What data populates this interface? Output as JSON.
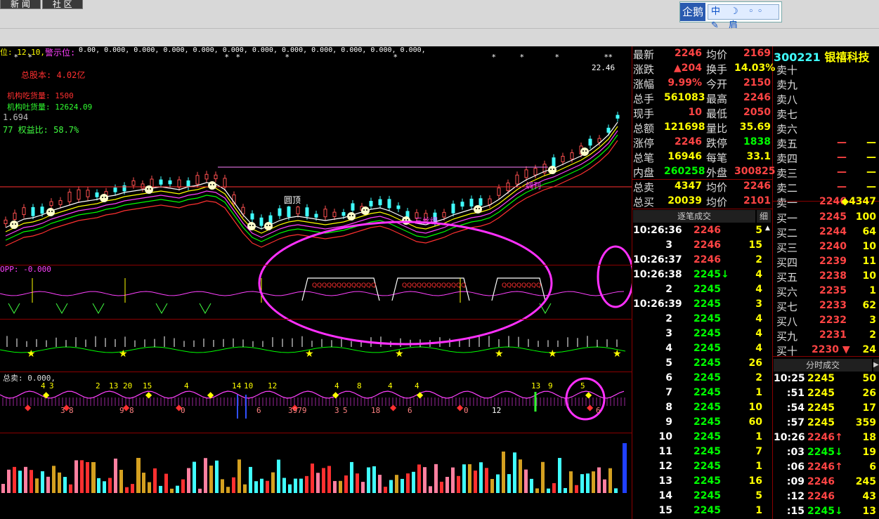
{
  "tabs": [
    "新 闻",
    "社 区"
  ],
  "qq": {
    "avatar": "企鹅",
    "tools": "中 ☽ ◦◦ ✎ 肩"
  },
  "indicators": {
    "warn": "位: 12.10,",
    "alarm_label": "警示位:",
    "alarm_values": "0.00, 0.000, 0.000, 0.000, 0.000, 0.000, 0.000, 0.000, 0.000, 0.000, 0.000, 0.000,",
    "equity": "总股本: 4.02亿",
    "inst_buy": "机构吃货量: 1500",
    "inst_sell": "机构吐货量: 12624.09",
    "v1": "1.694",
    "ratio": "77    权益比: 58.7%",
    "price_top": "22.46",
    "opp": "OPP: -0.000",
    "total_sell": "总卖: 0.000,"
  },
  "annotations": {
    "round_top": "圆顶",
    "shaokai": "绸刊",
    "sanqing": "三丝绸"
  },
  "subchart_numbers": {
    "top": [
      "4",
      "3",
      "2",
      "13",
      "20",
      "15",
      "4",
      "14",
      "10",
      "12",
      "4",
      "8",
      "4",
      "4",
      "13",
      "9",
      "5"
    ],
    "bottom": [
      "3",
      "8",
      "9",
      "8",
      "0",
      "6",
      "3979",
      "3",
      "5",
      "18",
      "6",
      "12",
      "0",
      "6"
    ]
  },
  "stock": {
    "code": "300221",
    "name": "银禧科技"
  },
  "quote": [
    {
      "l1": "最新",
      "v1": "2246",
      "c1": "#f44",
      "l2": "均价",
      "v2": "2169",
      "c2": "#f44"
    },
    {
      "l1": "涨跌",
      "v1": "▲204",
      "c1": "#f44",
      "l2": "换手",
      "v2": "14.03%",
      "c2": "#ffff00"
    },
    {
      "l1": "涨幅",
      "v1": "9.99%",
      "c1": "#f44",
      "l2": "今开",
      "v2": "2150",
      "c2": "#f44"
    },
    {
      "l1": "总手",
      "v1": "561083",
      "c1": "#ffff00",
      "l2": "最高",
      "v2": "2246",
      "c2": "#f44"
    },
    {
      "l1": "现手",
      "v1": "10",
      "c1": "#f44",
      "l2": "最低",
      "v2": "2050",
      "c2": "#f44"
    },
    {
      "l1": "总额",
      "v1": "121698",
      "c1": "#ffff00",
      "l2": "量比",
      "v2": "35.69",
      "c2": "#ffff00"
    },
    {
      "l1": "涨停",
      "v1": "2246",
      "c1": "#f44",
      "l2": "跌停",
      "v2": "1838",
      "c2": "#0f0"
    },
    {
      "l1": "总笔",
      "v1": "16946",
      "c1": "#ffff00",
      "l2": "每笔",
      "v2": "33.1",
      "c2": "#ffff00"
    },
    {
      "l1": "内盘",
      "v1": "260258",
      "c1": "#0f0",
      "l2": "外盘",
      "v2": "300825",
      "c2": "#f44"
    },
    {
      "l1": "总卖",
      "v1": "4347",
      "c1": "#ffff00",
      "l2": "均价",
      "v2": "2246",
      "c2": "#f44"
    },
    {
      "l1": "总买",
      "v1": "20039",
      "c1": "#ffff00",
      "l2": "均价",
      "v2": "2101",
      "c2": "#f44"
    }
  ],
  "sells": [
    {
      "l": "卖十",
      "p": "",
      "v": ""
    },
    {
      "l": "卖九",
      "p": "",
      "v": ""
    },
    {
      "l": "卖八",
      "p": "",
      "v": ""
    },
    {
      "l": "卖七",
      "p": "",
      "v": ""
    },
    {
      "l": "卖六",
      "p": "",
      "v": ""
    },
    {
      "l": "卖五",
      "p": "—",
      "v": "—"
    },
    {
      "l": "卖四",
      "p": "—",
      "v": "—"
    },
    {
      "l": "卖三",
      "p": "—",
      "v": "—"
    },
    {
      "l": "卖二",
      "p": "—",
      "v": "—"
    },
    {
      "l": "卖一",
      "p": "2246",
      "v": "◆4347"
    }
  ],
  "buys": [
    {
      "l": "买一",
      "p": "2245",
      "v": "100"
    },
    {
      "l": "买二",
      "p": "2244",
      "v": "64"
    },
    {
      "l": "买三",
      "p": "2240",
      "v": "10"
    },
    {
      "l": "买四",
      "p": "2239",
      "v": "11"
    },
    {
      "l": "买五",
      "p": "2238",
      "v": "10"
    },
    {
      "l": "买六",
      "p": "2235",
      "v": "1"
    },
    {
      "l": "买七",
      "p": "2233",
      "v": "62"
    },
    {
      "l": "买八",
      "p": "2232",
      "v": "3"
    },
    {
      "l": "买九",
      "p": "2231",
      "v": "2"
    },
    {
      "l": "买十",
      "p": "2230 ▼",
      "v": "24"
    }
  ],
  "ticks_header": "逐笔成交",
  "ticks_detail": "细",
  "ticks": [
    {
      "t": "10:26:36",
      "p": "2246",
      "v": "5",
      "c": "#f44"
    },
    {
      "t": "3",
      "p": "2246",
      "v": "15",
      "c": "#f44"
    },
    {
      "t": "10:26:37",
      "p": "2246",
      "v": "2",
      "c": "#f44"
    },
    {
      "t": "10:26:38",
      "p": "2245↓",
      "v": "4",
      "c": "#0f0"
    },
    {
      "t": "2",
      "p": "2245",
      "v": "4",
      "c": "#0f0"
    },
    {
      "t": "10:26:39",
      "p": "2245",
      "v": "3",
      "c": "#0f0"
    },
    {
      "t": "2",
      "p": "2245",
      "v": "4",
      "c": "#0f0"
    },
    {
      "t": "3",
      "p": "2245",
      "v": "4",
      "c": "#0f0"
    },
    {
      "t": "4",
      "p": "2245",
      "v": "4",
      "c": "#0f0"
    },
    {
      "t": "5",
      "p": "2245",
      "v": "26",
      "c": "#0f0"
    },
    {
      "t": "6",
      "p": "2245",
      "v": "2",
      "c": "#0f0"
    },
    {
      "t": "7",
      "p": "2245",
      "v": "1",
      "c": "#0f0"
    },
    {
      "t": "8",
      "p": "2245",
      "v": "10",
      "c": "#0f0"
    },
    {
      "t": "9",
      "p": "2245",
      "v": "60",
      "c": "#0f0"
    },
    {
      "t": "10",
      "p": "2245",
      "v": "1",
      "c": "#0f0"
    },
    {
      "t": "11",
      "p": "2245",
      "v": "7",
      "c": "#0f0"
    },
    {
      "t": "12",
      "p": "2245",
      "v": "1",
      "c": "#0f0"
    },
    {
      "t": "13",
      "p": "2245",
      "v": "16",
      "c": "#0f0"
    },
    {
      "t": "14",
      "p": "2245",
      "v": "5",
      "c": "#0f0"
    },
    {
      "t": "15",
      "p": "2245",
      "v": "1",
      "c": "#0f0"
    }
  ],
  "minute_header": "分时成交",
  "minute": [
    {
      "t": "10:25",
      "p": "2245",
      "v": "50",
      "c": "#ffff00"
    },
    {
      "t": ":51",
      "p": "2245",
      "v": "26",
      "c": "#ffff00"
    },
    {
      "t": ":54",
      "p": "2245",
      "v": "17",
      "c": "#ffff00"
    },
    {
      "t": ":57",
      "p": "2245",
      "v": "359",
      "c": "#ffff00"
    },
    {
      "t": "10:26",
      "p": "2246↑",
      "v": "18",
      "c": "#f44"
    },
    {
      "t": ":03",
      "p": "2245↓",
      "v": "19",
      "c": "#0f0"
    },
    {
      "t": ":06",
      "p": "2246↑",
      "v": "6",
      "c": "#f44"
    },
    {
      "t": ":09",
      "p": "2246",
      "v": "245",
      "c": "#f44"
    },
    {
      "t": ":12",
      "p": "2246",
      "v": "43",
      "c": "#f44"
    },
    {
      "t": ":15",
      "p": "2245↓",
      "v": "13",
      "c": "#0f0"
    }
  ]
}
